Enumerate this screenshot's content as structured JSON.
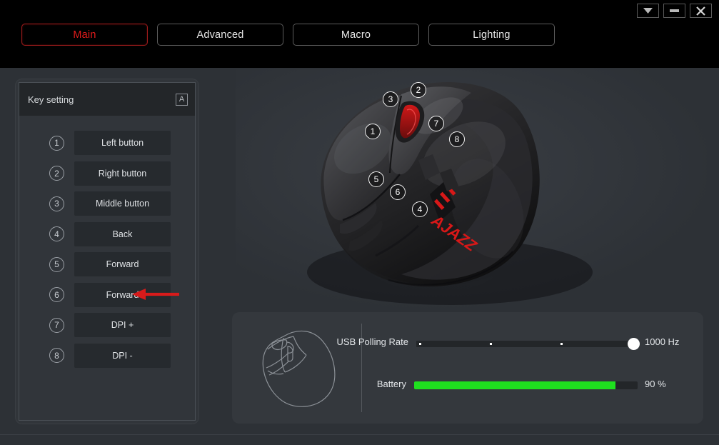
{
  "window": {
    "controls": [
      {
        "name": "tray-button",
        "glyph": "▼"
      },
      {
        "name": "minimize-button",
        "glyph": "—"
      },
      {
        "name": "close-button",
        "glyph": "✕"
      }
    ]
  },
  "tabs": [
    {
      "label": "Main",
      "active": true
    },
    {
      "label": "Advanced",
      "active": false
    },
    {
      "label": "Macro",
      "active": false
    },
    {
      "label": "Lighting",
      "active": false
    }
  ],
  "key_setting": {
    "title": "Key setting",
    "profile_icon": "A",
    "rows": [
      {
        "num": "1",
        "label": "Left button"
      },
      {
        "num": "2",
        "label": "Right button"
      },
      {
        "num": "3",
        "label": "Middle button"
      },
      {
        "num": "4",
        "label": "Back"
      },
      {
        "num": "5",
        "label": "Forward"
      },
      {
        "num": "6",
        "label": "Forward"
      },
      {
        "num": "7",
        "label": "DPI +"
      },
      {
        "num": "8",
        "label": "DPI -"
      }
    ]
  },
  "mouse_image": {
    "brand_logo": "AJAZZ",
    "callouts": [
      "1",
      "2",
      "3",
      "4",
      "5",
      "6",
      "7",
      "8"
    ]
  },
  "settings": {
    "polling": {
      "label": "USB Polling Rate",
      "value": "1000 Hz",
      "steps": 4,
      "selected_step": 4
    },
    "battery": {
      "label": "Battery",
      "value": "90 %",
      "percent": 90
    }
  },
  "colors": {
    "accent_red": "#e21b1b",
    "battery_green": "#1fe01f",
    "panel_bg": "#34383d",
    "page_bg": "#2d3136"
  }
}
